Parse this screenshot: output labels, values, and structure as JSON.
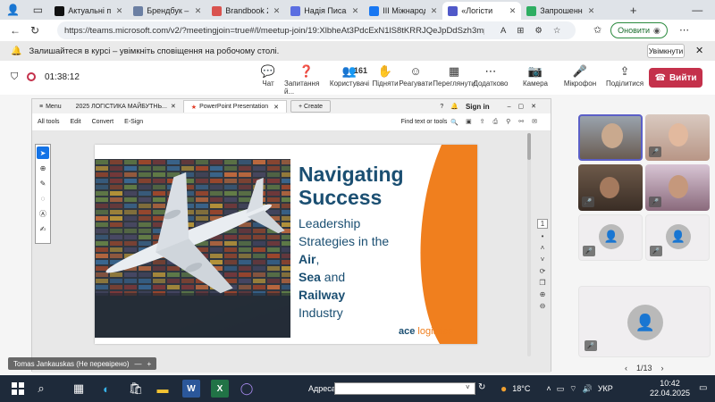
{
  "browser": {
    "tabs": [
      {
        "title": "Актуальні пит",
        "color": "#111111"
      },
      {
        "title": "Брендбук – Бр",
        "color": "#6b7fa3"
      },
      {
        "title": "Brandbook 20",
        "color": "#d9534f"
      },
      {
        "title": "Надія Писаре",
        "color": "#5b6ee1"
      },
      {
        "title": "ІІІ Міжнарод",
        "color": "#1877f2"
      },
      {
        "title": "«Логісти",
        "color": "#5059c9",
        "active": true
      },
      {
        "title": "Запрошення",
        "color": "#2eae62"
      }
    ],
    "url": "https://teams.microsoft.com/v2/?meetingjoin=true#/l/meetup-join/19:XlbheAt3PdcExN1lS8tKRRJQeJpDdSzh3mp...",
    "update_label": "Оновити",
    "new_tab_symbol": "+",
    "window_min": "—"
  },
  "notification": {
    "text": "Залишайтеся в курсі – увімкніть сповіщення на робочому столі.",
    "button": "Увімкнути"
  },
  "meeting": {
    "timer": "01:38:12",
    "tools": [
      {
        "label": "Чат",
        "icon": "💬"
      },
      {
        "label": "Запитання й...",
        "icon": "❓"
      },
      {
        "label": "Користувачі",
        "icon": "👥",
        "count": "161"
      },
      {
        "label": "Підняти",
        "icon": "✋"
      },
      {
        "label": "Реагувати",
        "icon": "☺"
      },
      {
        "label": "Переглянути",
        "icon": "▦"
      },
      {
        "label": "Додатково",
        "icon": "⋯"
      },
      {
        "label": "Камера",
        "icon": "📷"
      },
      {
        "label": "Мікрофон",
        "icon": "🎤"
      },
      {
        "label": "Поділитися",
        "icon": "⇪"
      }
    ],
    "leave_label": "Вийти"
  },
  "pdf": {
    "tabs": [
      "Menu",
      "2025 ЛОГІСТИКА МАЙБУТНЬ...",
      "PowerPoint Presentation",
      "Create"
    ],
    "menu": [
      "All tools",
      "Edit",
      "Convert",
      "E-Sign"
    ],
    "find_label": "Find text or tools",
    "sign_in": "Sign in",
    "page_number": "1"
  },
  "slide": {
    "title_line1": "Navigating",
    "title_line2": "Success",
    "sub_line1": "Leadership",
    "sub_line2": "Strategies in the",
    "air": "Air",
    "comma": ",",
    "sea": "Sea",
    "and": " and",
    "railway": "Railway",
    "industry": "Industry",
    "logo_a": "ace",
    "logo_b": "logistics",
    "orange": "#f07f1e",
    "navy": "#1b4f72"
  },
  "participants": {
    "pager": "1/13",
    "name_chip": "Tomas Jankauskas (Не перевірено)"
  },
  "taskbar": {
    "address_label": "Адреса",
    "temperature": "18°C",
    "language": "УКР",
    "time": "10:42",
    "date": "22.04.2025"
  }
}
